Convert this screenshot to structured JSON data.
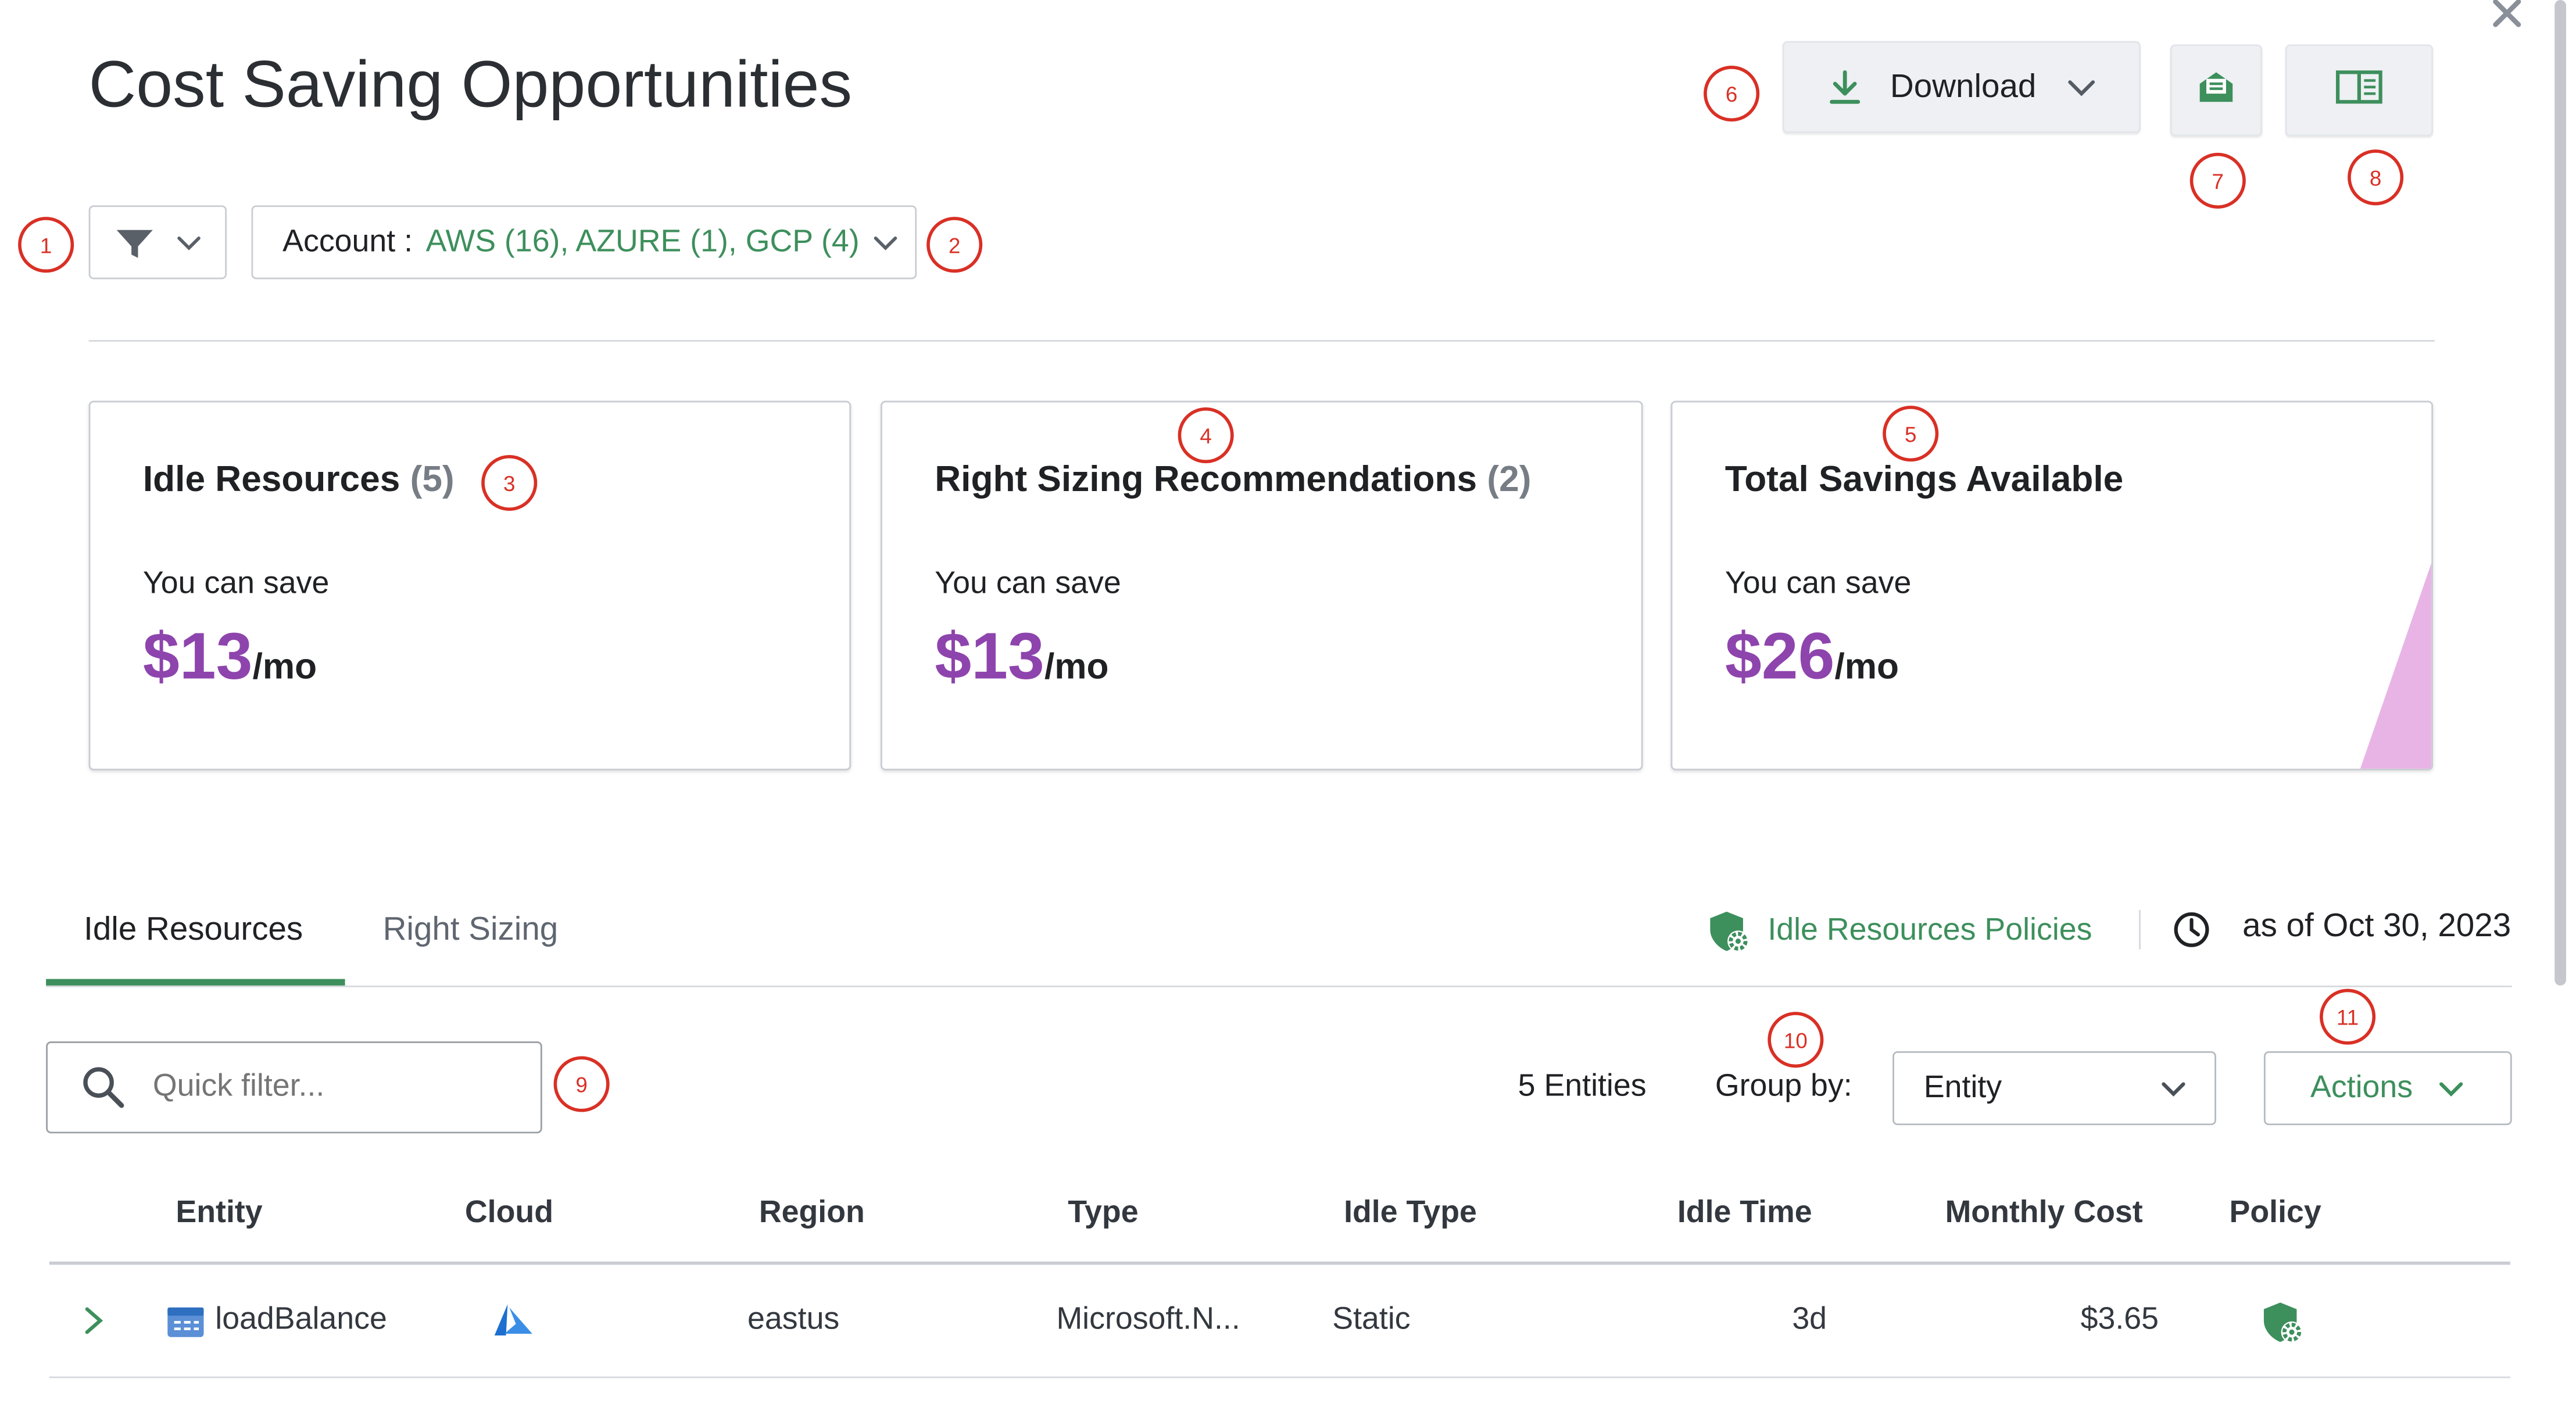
{
  "header": {
    "title": "Cost Saving Opportunities",
    "download_label": "Download"
  },
  "filters": {
    "account_label": "Account :",
    "account_value": "AWS (16), AZURE (1), GCP (4)"
  },
  "cards": [
    {
      "title": "Idle Resources",
      "count": "(5)",
      "sub": "You can save",
      "amount": "$13",
      "unit": "/mo"
    },
    {
      "title": "Right Sizing Recommendations",
      "count": "(2)",
      "sub": "You can save",
      "amount": "$13",
      "unit": "/mo"
    },
    {
      "title": "Total Savings Available",
      "count": "",
      "sub": "You can save",
      "amount": "$26",
      "unit": "/mo"
    }
  ],
  "tabs": {
    "idle": "Idle Resources",
    "right_sizing": "Right Sizing",
    "active": "idle"
  },
  "policies_link": "Idle Resources Policies",
  "as_of": "as of Oct 30, 2023",
  "toolbar": {
    "search_placeholder": "Quick filter...",
    "entities_count": "5 Entities",
    "group_by_label": "Group by:",
    "group_by_value": "Entity",
    "actions_label": "Actions"
  },
  "table": {
    "headers": [
      "Entity",
      "Cloud",
      "Region",
      "Type",
      "Idle Type",
      "Idle Time",
      "Monthly Cost",
      "Policy"
    ],
    "rows": [
      {
        "entity": "loadBalance",
        "cloud_icon": "azure-icon",
        "region": "eastus",
        "type": "Microsoft.N...",
        "idle_type": "Static",
        "idle_time": "3d",
        "monthly_cost": "$3.65",
        "policy_icon": "policy-shield-icon"
      }
    ]
  },
  "callouts": [
    "1",
    "2",
    "3",
    "4",
    "5",
    "6",
    "7",
    "8",
    "9",
    "10",
    "11"
  ],
  "colors": {
    "accent_green": "#3d8f5c",
    "amount_purple": "#8e44ad",
    "callout_red": "#d93025",
    "wedge_pink": "#e8b4e6"
  },
  "icons": [
    "filter-icon",
    "download-icon",
    "email-icon",
    "book-icon",
    "close-icon",
    "search-icon",
    "clock-icon",
    "shield-gear-icon",
    "azure-icon",
    "load-balancer-icon"
  ]
}
